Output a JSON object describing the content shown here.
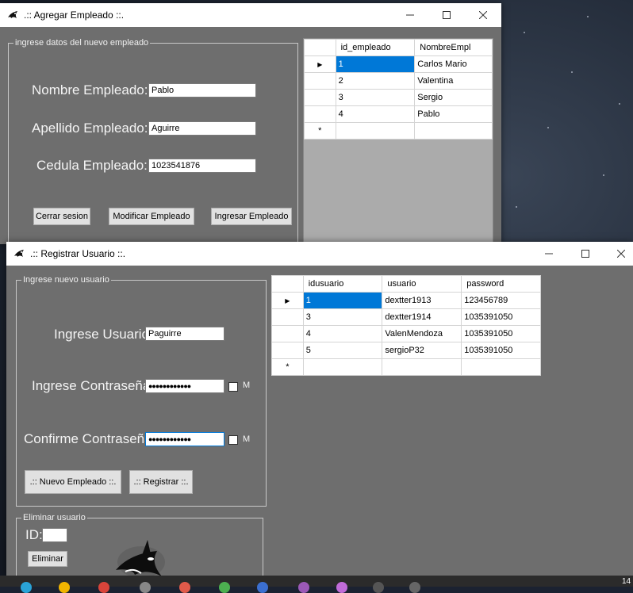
{
  "window1": {
    "title": ".:: Agregar Empleado ::.",
    "group_title": "ingrese datos del nuevo empleado",
    "nombre_label": "Nombre Empleado:",
    "nombre_value": "Pablo",
    "apellido_label": "Apellido Empleado:",
    "apellido_value": "Aguirre",
    "cedula_label": "Cedula Empleado:",
    "cedula_value": "1023541876",
    "btn_cerrar": "Cerrar sesion",
    "btn_modificar": "Modificar Empleado",
    "btn_ingresar": "Ingresar Empleado",
    "grid": {
      "columns": [
        "id_empleado",
        "NombreEmpl"
      ],
      "rows": [
        {
          "id": "1",
          "name": "Carlos Mario"
        },
        {
          "id": "2",
          "name": "Valentina"
        },
        {
          "id": "3",
          "name": "Sergio"
        },
        {
          "id": "4",
          "name": "Pablo"
        }
      ],
      "new_row_marker": "*",
      "current_row_marker": "▶"
    }
  },
  "window2": {
    "title": ".:: Registrar Usuario ::.",
    "group_title": "Ingrese nuevo usuario",
    "usuario_label": "Ingrese Usuario",
    "usuario_value": "Paguirre",
    "pass_label": "Ingrese Contraseña",
    "pass_value": "●●●●●●●●●●●●",
    "confirm_label": "Confirme Contraseña",
    "confirm_value": "●●●●●●●●●●●●",
    "show_label": "M",
    "btn_nuevo_empleado": ".:: Nuevo Empleado ::.",
    "btn_registrar": ".:: Registrar ::.",
    "delete_group_title": "Eliminar usuario",
    "id_label": "ID:",
    "btn_eliminar": "Eliminar",
    "grid": {
      "columns": [
        "idusuario",
        "usuario",
        "password"
      ],
      "rows": [
        {
          "id": "1",
          "user": "dextter1913",
          "pass": "123456789"
        },
        {
          "id": "3",
          "user": "dextter1914",
          "pass": "1035391050"
        },
        {
          "id": "4",
          "user": "ValenMendoza",
          "pass": "1035391050"
        },
        {
          "id": "5",
          "user": "sergioP32",
          "pass": "1035391050"
        }
      ],
      "new_row_marker": "*",
      "current_row_marker": "▶"
    }
  },
  "titlebar_icons": {
    "minimize": "minimize-icon",
    "maximize": "maximize-icon",
    "close": "close-icon"
  },
  "clock_partial": "14"
}
